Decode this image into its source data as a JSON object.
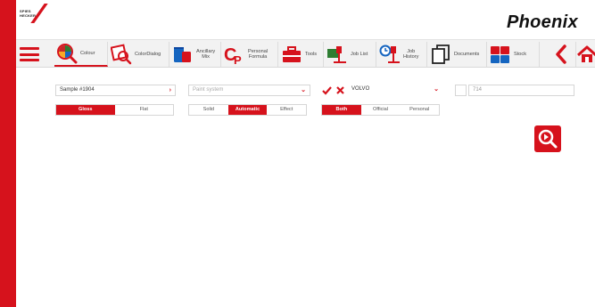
{
  "header": {
    "logo_line1": "SPIES",
    "logo_line2": "HECKER",
    "brand": "Phoenix"
  },
  "toolbar": {
    "items": [
      {
        "label": "Colour",
        "icon": "colour-search-icon"
      },
      {
        "label": "ColorDialog",
        "icon": "color-dialog-icon"
      },
      {
        "label": "Ancillary\nMix",
        "icon": "ancillary-mix-icon"
      },
      {
        "label": "Personal\nFormula",
        "icon": "personal-formula-icon"
      },
      {
        "label": "Tools",
        "icon": "toolbox-icon"
      },
      {
        "label": "Job List",
        "icon": "job-list-icon"
      },
      {
        "label": "Job\nHistory",
        "icon": "job-history-icon"
      },
      {
        "label": "Documents",
        "icon": "documents-icon"
      },
      {
        "label": "Stock",
        "icon": "stock-icon"
      }
    ]
  },
  "search": {
    "sample_value": "Sample #1904",
    "paint_system_placeholder": "Paint system",
    "make_value": "VOLVO",
    "code_value": "714"
  },
  "finish": {
    "gloss": "Gloss",
    "flat": "Flat"
  },
  "type": {
    "solid": "Solid",
    "automatic": "Automatic",
    "effect": "Effect"
  },
  "source": {
    "both": "Both",
    "official": "Official",
    "personal": "Personal"
  },
  "colors": {
    "accent": "#d6121c",
    "toolbar_bg": "#f2f2f2"
  }
}
